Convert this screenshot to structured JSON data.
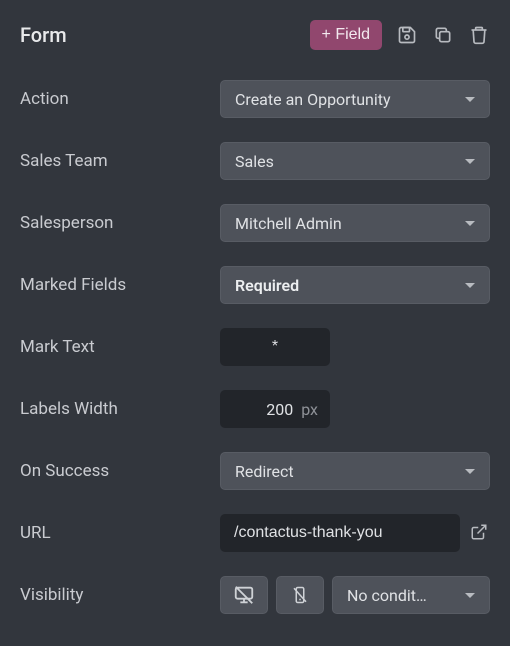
{
  "header": {
    "title": "Form",
    "add_field_label": "+ Field"
  },
  "fields": {
    "action": {
      "label": "Action",
      "value": "Create an Opportunity"
    },
    "sales_team": {
      "label": "Sales Team",
      "value": "Sales"
    },
    "salesperson": {
      "label": "Salesperson",
      "value": "Mitchell Admin"
    },
    "marked_fields": {
      "label": "Marked Fields",
      "value": "Required"
    },
    "mark_text": {
      "label": "Mark Text",
      "value": "*"
    },
    "labels_width": {
      "label": "Labels Width",
      "value": "200",
      "unit": "px"
    },
    "on_success": {
      "label": "On Success",
      "value": "Redirect"
    },
    "url": {
      "label": "URL",
      "value": "/contactus-thank-you"
    },
    "visibility": {
      "label": "Visibility",
      "value": "No condit…"
    }
  }
}
